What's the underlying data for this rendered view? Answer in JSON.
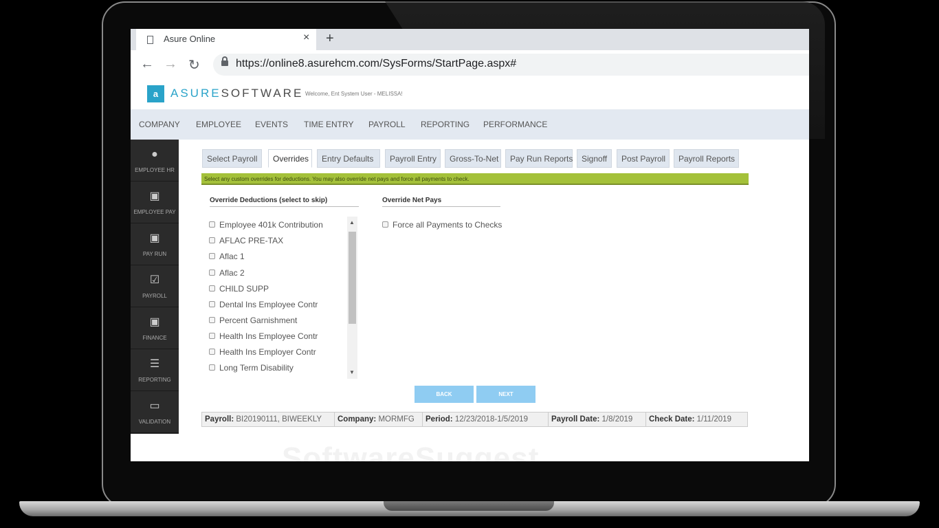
{
  "browser": {
    "tab_title": "Asure Online",
    "tab_close": "×",
    "new_tab": "+",
    "back": "←",
    "forward": "→",
    "reload": "↻",
    "url": "https://online8.asurehcm.com/SysForms/StartPage.aspx#"
  },
  "header": {
    "logo_icon": "a",
    "logo_asure": "ASURE",
    "logo_software": "SOFTWARE",
    "welcome": "Welcome, Ent System User - MELISSA!"
  },
  "menu": [
    "COMPANY",
    "EMPLOYEE",
    "EVENTS",
    "TIME ENTRY",
    "PAYROLL",
    "REPORTING",
    "PERFORMANCE"
  ],
  "sidebar": [
    {
      "label": "EMPLOYEE HR",
      "icon": "person-icon"
    },
    {
      "label": "EMPLOYEE PAY",
      "icon": "money-icon"
    },
    {
      "label": "PAY RUN",
      "icon": "money-icon"
    },
    {
      "label": "PAYROLL",
      "icon": "checkbox-icon"
    },
    {
      "label": "FINANCE",
      "icon": "money-icon"
    },
    {
      "label": "REPORTING",
      "icon": "list-icon"
    },
    {
      "label": "VALIDATION",
      "icon": "monitor-icon"
    }
  ],
  "subtabs": [
    "Select Payroll",
    "Overrides",
    "Entry Defaults",
    "Payroll Entry",
    "Gross-To-Net",
    "Pay Run Reports",
    "Signoff",
    "Post Payroll",
    "Payroll Reports"
  ],
  "active_subtab": "Overrides",
  "info": "Select any custom overrides for deductions. You may also override net pays and force all payments to check.",
  "deductions": {
    "heading": "Override Deductions (select to skip)",
    "items": [
      "Employee 401k Contribution",
      "AFLAC PRE-TAX",
      "Aflac 1",
      "Aflac 2",
      "CHILD SUPP",
      "Dental Ins Employee Contr",
      "Percent Garnishment",
      "Health Ins Employee Contr",
      "Health Ins Employer Contr",
      "Long Term Disability"
    ]
  },
  "netpays": {
    "heading": "Override Net Pays",
    "force_label": "Force all Payments to Checks"
  },
  "buttons": {
    "back": "BACK",
    "next": "NEXT"
  },
  "footer": {
    "payroll_label": "Payroll:",
    "payroll_value": "BI20190111, BIWEEKLY",
    "company_label": "Company:",
    "company_value": "MORMFG",
    "period_label": "Period:",
    "period_value": "12/23/2018-1/5/2019",
    "paydate_label": "Payroll Date:",
    "paydate_value": "1/8/2019",
    "checkdate_label": "Check Date:",
    "checkdate_value": "1/11/2019"
  },
  "watermark": "SoftwareSuggest",
  "colors": {
    "accent": "#2aa3c9",
    "infobar": "#a4c13a",
    "button": "#8fccf2",
    "sidebar": "#2b2b2b"
  }
}
